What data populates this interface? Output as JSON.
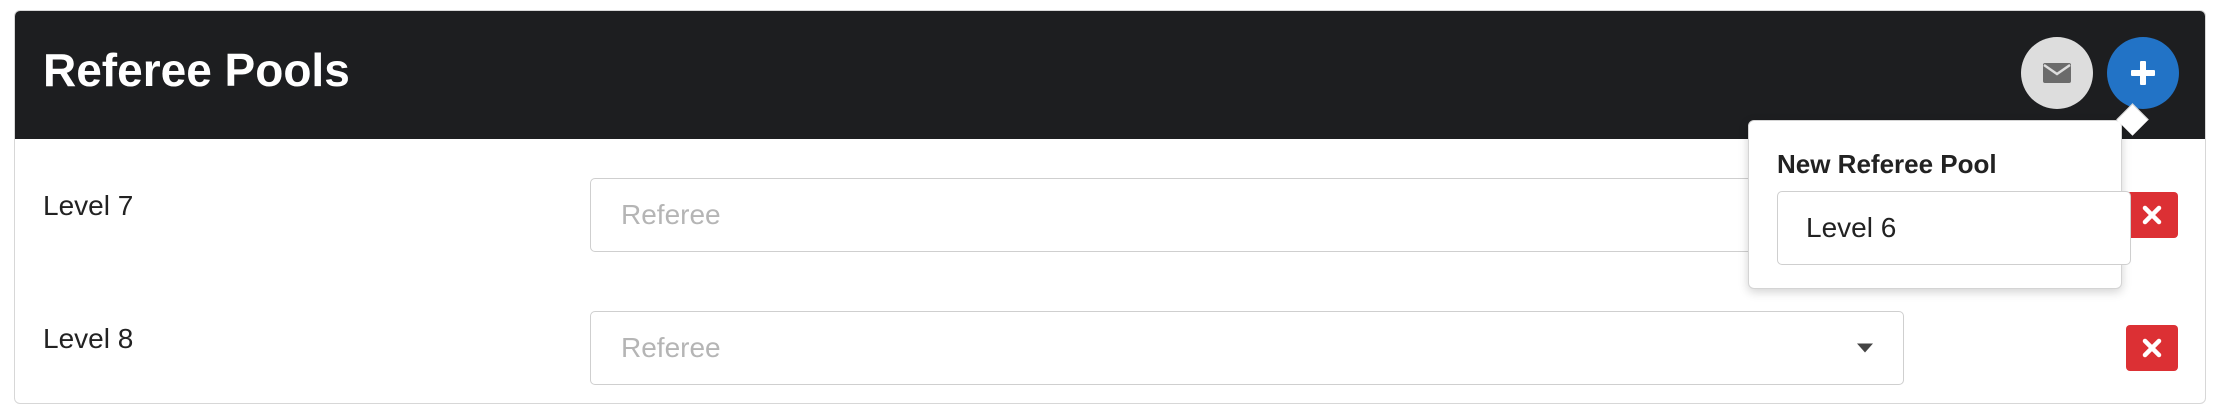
{
  "header": {
    "title": "Referee Pools",
    "email_icon": "envelope-icon",
    "add_icon": "plus-icon"
  },
  "pools": [
    {
      "label": "Level 7",
      "select_placeholder": "Referee"
    },
    {
      "label": "Level 8",
      "select_placeholder": "Referee"
    }
  ],
  "popover": {
    "title": "New Referee Pool",
    "input_value": "Level 6"
  },
  "colors": {
    "header_bg": "#1d1e20",
    "add_button": "#2273c6",
    "email_button": "#dddddd",
    "delete_button": "#dc3034"
  }
}
